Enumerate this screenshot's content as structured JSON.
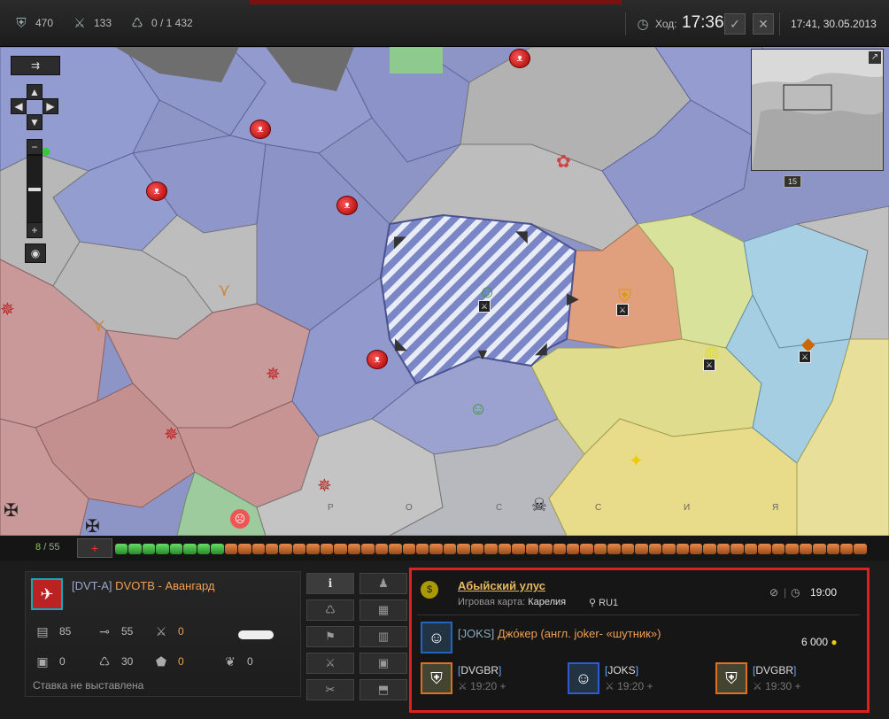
{
  "topbar": {
    "gold": "470",
    "battles": "133",
    "influence": "0 / 1 432",
    "turn_label": "Ход:",
    "turn_time": "17:36",
    "datetime": "17:41, 30.05.2013",
    "icons": [
      "shield-icon",
      "crossed-swords-icon",
      "influence-icon",
      "clock-icon",
      "check-icon",
      "close-icon"
    ]
  },
  "map": {
    "minimap_badge": "15",
    "region_letters": [
      "Р",
      "О",
      "С",
      "С",
      "И",
      "Я"
    ]
  },
  "bar": {
    "count": "8",
    "total": "/ 55",
    "add_label": "+",
    "filled_slots": 8,
    "total_slots": 55
  },
  "clan": {
    "tag": "[DVT-A]",
    "name": "DVOTB - Авангард",
    "stats": {
      "tanks": "85",
      "guns": "55",
      "attacks": "0",
      "defs": "0",
      "respawns": "30",
      "provinces": "0",
      "wins": "0"
    },
    "bet": "Ставка не выставлена"
  },
  "province": {
    "name": "Абыйский улус",
    "map_label": "Игровая карта:",
    "map_name": "Карелия",
    "server": "RU1",
    "time": "19:00",
    "owner_tag": "JOKS",
    "owner_name": "Джо́кер (англ. joker- «шутник»)",
    "income": "6 000",
    "attackers": [
      {
        "tag": "DVGBR",
        "time": "19:20 +",
        "color": "#e07020"
      },
      {
        "tag": "JOKS",
        "time": "19:20 +",
        "color": "#2e5bd0"
      },
      {
        "tag": "DVGBR",
        "time": "19:30 +",
        "color": "#e07020"
      }
    ]
  }
}
